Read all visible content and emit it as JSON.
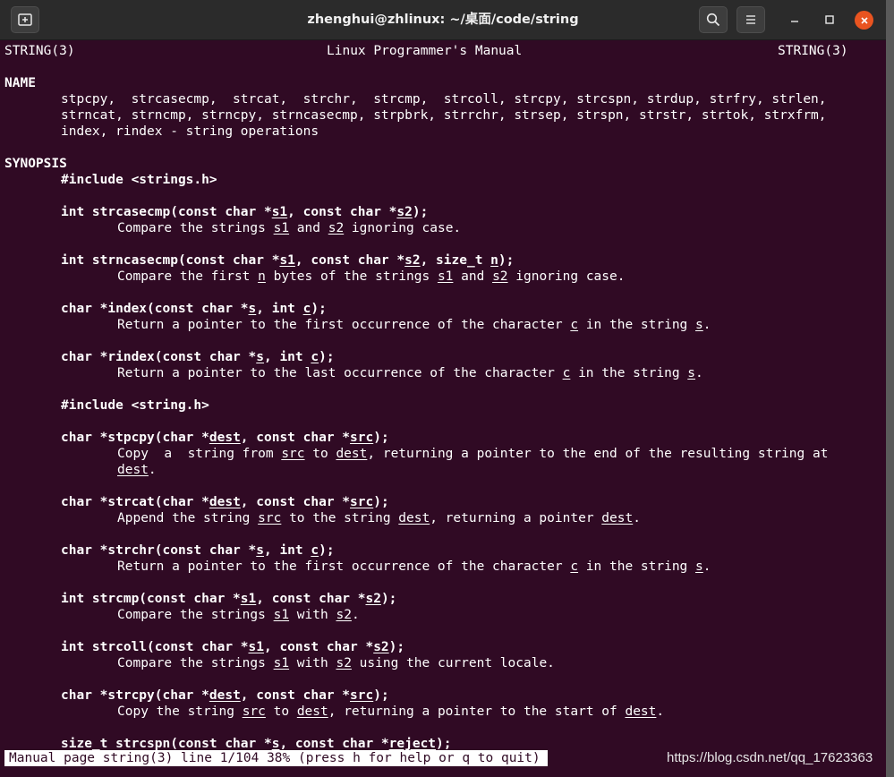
{
  "window": {
    "title": "zhenghui@zhlinux: ~/桌面/code/string",
    "new_tab_icon": "new-tab-icon",
    "search_icon": "search-icon",
    "menu_icon": "hamburger-menu-icon"
  },
  "header": {
    "left": "STRING(3)",
    "center": "Linux Programmer's Manual",
    "right": "STRING(3)"
  },
  "name_section": {
    "heading": "NAME",
    "line1": "stpcpy,  strcasecmp,  strcat,  strchr,  strcmp,  strcoll, strcpy, strcspn, strdup, strfry, strlen,",
    "line2": "strncat, strncmp, strncpy, strncasecmp, strpbrk, strrchr, strsep, strspn, strstr, strtok, strxfrm,",
    "line3": "index, rindex - string operations"
  },
  "synopsis": {
    "heading": "SYNOPSIS",
    "include1": "#include <strings.h>",
    "include2": "#include <string.h>"
  },
  "entries": {
    "strcasecmp": {
      "sig_a": "int strcasecmp(const char *",
      "p1": "s1",
      "sig_b": ", const char *",
      "p2": "s2",
      "sig_c": ");",
      "desc_a": "Compare the strings ",
      "d1": "s1",
      "desc_b": " and ",
      "d2": "s2",
      "desc_c": " ignoring case."
    },
    "strncasecmp": {
      "sig_a": "int strncasecmp(const char *",
      "p1": "s1",
      "sig_b": ", const char *",
      "p2": "s2",
      "sig_c": ", size_t ",
      "p3": "n",
      "sig_d": ");",
      "desc_a": "Compare the first ",
      "d1": "n",
      "desc_b": " bytes of the strings ",
      "d2": "s1",
      "desc_c": " and ",
      "d3": "s2",
      "desc_d": " ignoring case."
    },
    "index": {
      "sig_a": "char *index(const char *",
      "p1": "s",
      "sig_b": ", int ",
      "p2": "c",
      "sig_c": ");",
      "desc_a": "Return a pointer to the first occurrence of the character ",
      "d1": "c",
      "desc_b": " in the string ",
      "d2": "s",
      "desc_c": "."
    },
    "rindex": {
      "sig_a": "char *rindex(const char *",
      "p1": "s",
      "sig_b": ", int ",
      "p2": "c",
      "sig_c": ");",
      "desc_a": "Return a pointer to the last occurrence of the character ",
      "d1": "c",
      "desc_b": " in the string ",
      "d2": "s",
      "desc_c": "."
    },
    "stpcpy": {
      "sig_a": "char *stpcpy(char *",
      "p1": "dest",
      "sig_b": ", const char *",
      "p2": "src",
      "sig_c": ");",
      "desc_a": "Copy  a  string from ",
      "d1": "src",
      "desc_b": " to ",
      "d2": "dest",
      "desc_c": ", returning a pointer to the end of the resulting string at",
      "desc2": "dest",
      "desc2_end": "."
    },
    "strcat": {
      "sig_a": "char *strcat(char *",
      "p1": "dest",
      "sig_b": ", const char *",
      "p2": "src",
      "sig_c": ");",
      "desc_a": "Append the string ",
      "d1": "src",
      "desc_b": " to the string ",
      "d2": "dest",
      "desc_c": ", returning a pointer ",
      "d3": "dest",
      "desc_d": "."
    },
    "strchr": {
      "sig_a": "char *strchr(const char *",
      "p1": "s",
      "sig_b": ", int ",
      "p2": "c",
      "sig_c": ");",
      "desc_a": "Return a pointer to the first occurrence of the character ",
      "d1": "c",
      "desc_b": " in the string ",
      "d2": "s",
      "desc_c": "."
    },
    "strcmp": {
      "sig_a": "int strcmp(const char *",
      "p1": "s1",
      "sig_b": ", const char *",
      "p2": "s2",
      "sig_c": ");",
      "desc_a": "Compare the strings ",
      "d1": "s1",
      "desc_b": " with ",
      "d2": "s2",
      "desc_c": "."
    },
    "strcoll": {
      "sig_a": "int strcoll(const char *",
      "p1": "s1",
      "sig_b": ", const char *",
      "p2": "s2",
      "sig_c": ");",
      "desc_a": "Compare the strings ",
      "d1": "s1",
      "desc_b": " with ",
      "d2": "s2",
      "desc_c": " using the current locale."
    },
    "strcpy": {
      "sig_a": "char *strcpy(char *",
      "p1": "dest",
      "sig_b": ", const char *",
      "p2": "src",
      "sig_c": ");",
      "desc_a": "Copy the string ",
      "d1": "src",
      "desc_b": " to ",
      "d2": "dest",
      "desc_c": ", returning a pointer to the start of ",
      "d3": "dest",
      "desc_d": "."
    },
    "strcspn": {
      "sig_a": "size_t strcspn(const char *",
      "p1": "s",
      "sig_b": ", const char *",
      "p2": "reject",
      "sig_c": ");"
    }
  },
  "status_line": "Manual page string(3) line 1/104 38% (press h for help or q to quit)",
  "watermark": "https://blog.csdn.net/qq_17623363",
  "colors": {
    "terminal_bg": "#300a24",
    "titlebar_bg": "#2b2b2b",
    "close_button": "#e95420",
    "text": "#ffffff"
  }
}
